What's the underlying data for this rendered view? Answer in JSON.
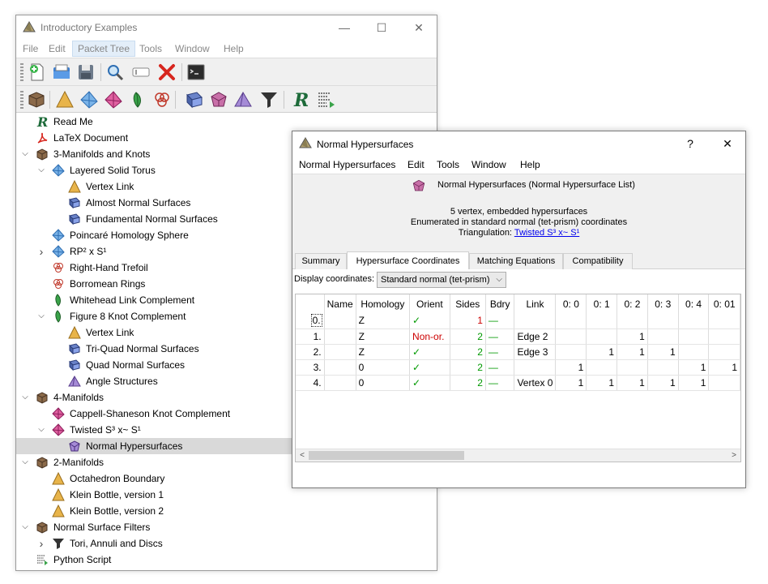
{
  "main_window": {
    "title": "Introductory Examples",
    "controls": {
      "minimize": "—",
      "maximize": "☐",
      "close": "✕"
    },
    "menu": [
      "File",
      "Edit",
      "Packet Tree",
      "Tools",
      "Window",
      "Help"
    ],
    "active_menu": "Packet Tree"
  },
  "toolbar1_icons": [
    "new-document-icon",
    "open-icon",
    "save-icon",
    "find-icon",
    "rename-icon",
    "delete-icon",
    "python-console-icon"
  ],
  "toolbar2_icons": [
    "container-icon",
    "triangulation-2d-icon",
    "triangulation-3d-icon",
    "triangulation-4d-icon",
    "snappea-icon",
    "link-icon",
    "surfaces-icon",
    "hypersurfaces-icon",
    "angle-structures-icon",
    "filter-icon",
    "text-icon",
    "script-icon"
  ],
  "tree": {
    "items": [
      {
        "label": "Read Me",
        "icon": "text-icon"
      },
      {
        "label": "LaTeX Document",
        "icon": "pdf-icon"
      },
      {
        "label": "3-Manifolds and Knots",
        "icon": "container-icon"
      },
      {
        "label": "Layered Solid Torus",
        "icon": "triangulation-3d-icon"
      },
      {
        "label": "Vertex Link",
        "icon": "triangulation-2d-icon"
      },
      {
        "label": "Almost Normal Surfaces",
        "icon": "surfaces-icon"
      },
      {
        "label": "Fundamental Normal Surfaces",
        "icon": "surfaces-icon"
      },
      {
        "label": "Poincaré Homology Sphere",
        "icon": "triangulation-3d-icon"
      },
      {
        "label": "RP² x S¹",
        "icon": "triangulation-3d-icon"
      },
      {
        "label": "Right-Hand Trefoil",
        "icon": "link-icon"
      },
      {
        "label": "Borromean Rings",
        "icon": "link-icon"
      },
      {
        "label": "Whitehead Link Complement",
        "icon": "snappea-icon"
      },
      {
        "label": "Figure 8 Knot Complement",
        "icon": "snappea-icon"
      },
      {
        "label": "Vertex Link",
        "icon": "triangulation-2d-icon"
      },
      {
        "label": "Tri-Quad Normal Surfaces",
        "icon": "surfaces-icon"
      },
      {
        "label": "Quad Normal Surfaces",
        "icon": "surfaces-icon"
      },
      {
        "label": "Angle Structures",
        "icon": "angle-structures-icon"
      },
      {
        "label": "4-Manifolds",
        "icon": "container-icon"
      },
      {
        "label": "Cappell-Shaneson Knot Complement",
        "icon": "triangulation-4d-icon"
      },
      {
        "label": "Twisted S³ x~ S¹",
        "icon": "triangulation-4d-icon"
      },
      {
        "label": "Normal Hypersurfaces",
        "icon": "hypersurfaces-icon"
      },
      {
        "label": "2-Manifolds",
        "icon": "container-icon"
      },
      {
        "label": "Octahedron Boundary",
        "icon": "triangulation-2d-icon"
      },
      {
        "label": "Klein Bottle, version 1",
        "icon": "triangulation-2d-icon"
      },
      {
        "label": "Klein Bottle, version 2",
        "icon": "triangulation-2d-icon"
      },
      {
        "label": "Normal Surface Filters",
        "icon": "container-icon"
      },
      {
        "label": "Tori, Annuli and Discs",
        "icon": "filter-icon"
      },
      {
        "label": "Python Script",
        "icon": "script-icon"
      }
    ],
    "selected": "Normal Hypersurfaces"
  },
  "dialog": {
    "title": "Normal Hypersurfaces",
    "help": "?",
    "close": "✕",
    "menu": [
      "Normal Hypersurfaces",
      "Edit",
      "Tools",
      "Window",
      "Help"
    ],
    "header": "Normal Hypersurfaces (Normal Hypersurface List)",
    "info_line1": "5 vertex, embedded hypersurfaces",
    "info_line2": "Enumerated in standard normal (tet-prism) coordinates",
    "info_line3_prefix": "Triangulation: ",
    "info_line3_link": "Twisted S³ x~ S¹",
    "tabs": [
      "Summary",
      "Hypersurface Coordinates",
      "Matching Equations",
      "Compatibility"
    ],
    "active_tab": "Hypersurface Coordinates",
    "display_label": "Display coordinates:",
    "display_value": "Standard normal (tet-prism)",
    "table": {
      "columns": [
        "",
        "Name",
        "Homology",
        "Orient",
        "Sides",
        "Bdry",
        "Link",
        "0: 0",
        "0: 1",
        "0: 2",
        "0: 3",
        "0: 4",
        "0: 01"
      ],
      "rows": [
        [
          "0.",
          "",
          "Z",
          "✓",
          "1",
          "—",
          "",
          "",
          "",
          "",
          "",
          "",
          ""
        ],
        [
          "1.",
          "",
          "Z",
          "Non-or.",
          "2",
          "—",
          "Edge 2",
          "",
          "",
          "1",
          "",
          "",
          ""
        ],
        [
          "2.",
          "",
          "Z",
          "✓",
          "2",
          "—",
          "Edge 3",
          "",
          "1",
          "1",
          "1",
          "",
          ""
        ],
        [
          "3.",
          "",
          "0",
          "✓",
          "2",
          "—",
          "",
          "1",
          "",
          "",
          "",
          "1",
          "1"
        ],
        [
          "4.",
          "",
          "0",
          "✓",
          "2",
          "—",
          "Vertex 0",
          "1",
          "1",
          "1",
          "1",
          "1",
          ""
        ]
      ]
    },
    "scroll_left": "<",
    "scroll_right": ">"
  },
  "colors": {
    "accent_red": "#cc0000",
    "accent_green": "#009900",
    "selection": "#d9d9d9",
    "link": "#0000ee"
  }
}
